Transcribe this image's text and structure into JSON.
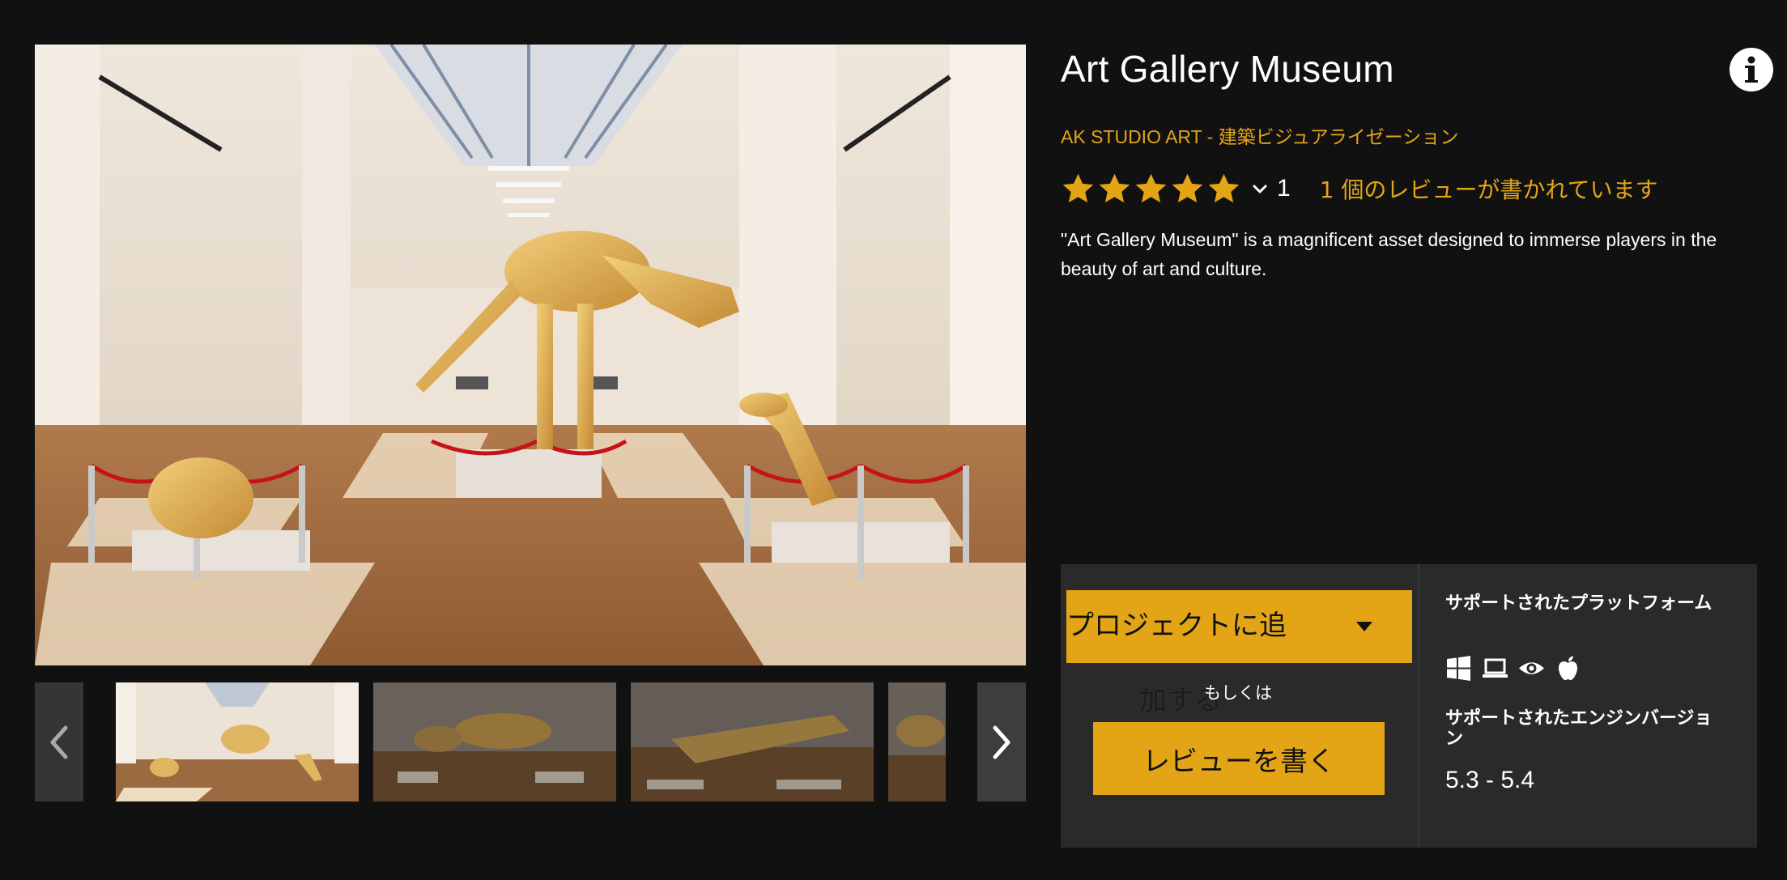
{
  "product": {
    "title": "Art Gallery Museum",
    "publisher": "AK STUDIO ART",
    "separator": " - ",
    "category": "建築ビジュアライゼーション",
    "rating": {
      "stars": 5,
      "count": "1",
      "reviews_text": "1 個のレビューが書かれています"
    },
    "description": "\"Art Gallery Museum\" is a magnificent asset designed to immerse players in the beauty of art and culture."
  },
  "actions": {
    "add_to_project_label": "プロジェクトに追",
    "add_to_project_wrap": "加する",
    "or_text": "もしくは",
    "write_review_label": "レビューを書く"
  },
  "specs": {
    "platforms_label": "サポートされたプラットフォーム",
    "platform_icons": [
      "windows-icon",
      "laptop-icon",
      "eye-icon",
      "apple-icon"
    ],
    "engine_label": "サポートされたエンジンバージョン",
    "engine_versions": "5.3 - 5.4"
  },
  "gallery": {
    "thumbnail_count": 4,
    "selected_index": 0
  },
  "colors": {
    "background": "#111111",
    "accent": "#e3a516",
    "panel": "#2a2a2a",
    "strip_button": "#3b3b3b"
  }
}
